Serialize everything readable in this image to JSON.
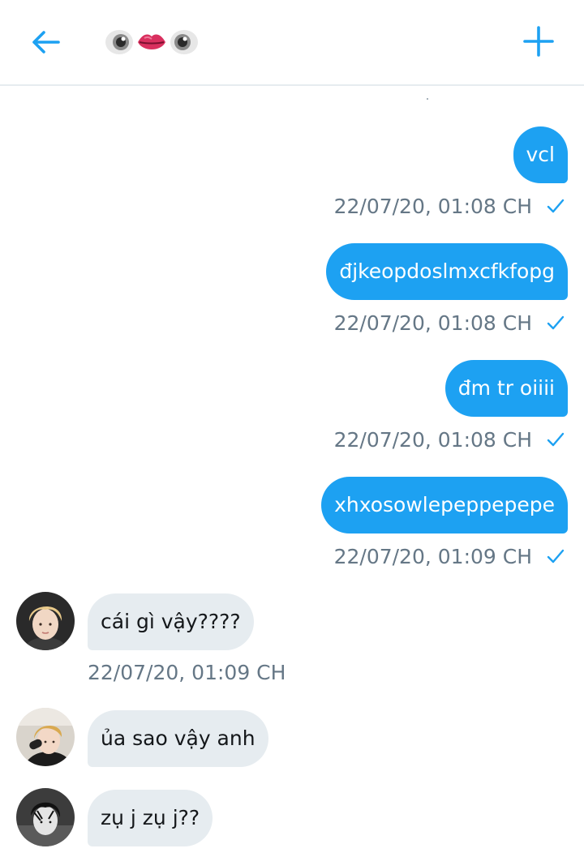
{
  "header": {
    "back_icon": "arrow-left-icon",
    "title_emojis": [
      "eye-icon",
      "lips-icon",
      "eye-icon"
    ],
    "add_icon": "plus-icon",
    "accent_color": "#1da1f2"
  },
  "messages_out": [
    {
      "text": "vcl",
      "time": "22/07/20, 01:08 CH"
    },
    {
      "text": "đjkeopdoslmxcfkfopg",
      "time": "22/07/20, 01:08 CH"
    },
    {
      "text": "đm tr oiiii",
      "time": "22/07/20, 01:08 CH"
    },
    {
      "text": "xhxosowlepeppepepe",
      "time": "22/07/20, 01:09 CH"
    }
  ],
  "messages_in": [
    {
      "text": "cái gì vậy????",
      "time": "22/07/20, 01:09 CH"
    },
    {
      "text": "ủa sao vậy anh",
      "time": ""
    },
    {
      "text": "zụ j zụ j??",
      "time": ""
    }
  ],
  "colors": {
    "outgoing_bubble": "#1da1f2",
    "incoming_bubble": "#e6ecf0",
    "meta_text": "#657786"
  }
}
